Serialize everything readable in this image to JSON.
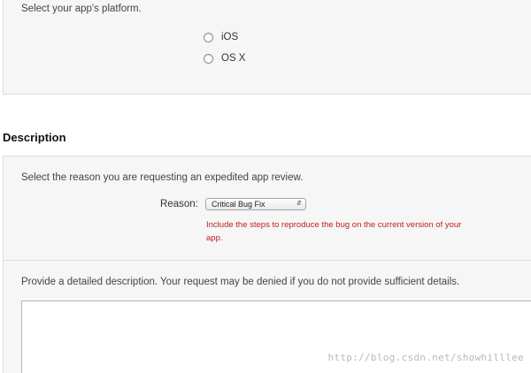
{
  "platform": {
    "instruction": "Select your app's platform.",
    "options": [
      {
        "label": "iOS",
        "selected": false
      },
      {
        "label": "OS X",
        "selected": false
      }
    ]
  },
  "description": {
    "heading": "Description",
    "reason_instruction": "Select the reason you are requesting an expedited app review.",
    "reason_label": "Reason:",
    "reason_selected": "Critical Bug Fix",
    "reason_arrow_icon": "updown-chevron-icon",
    "warning_text": "Include the steps to reproduce the bug on the current version of your app.",
    "warning_color": "#c0201e",
    "details_instruction": "Provide a detailed description. Your request may be denied if you do not provide sufficient details.",
    "details_value": ""
  },
  "watermark": "http://blog.csdn.net/showhilllee"
}
